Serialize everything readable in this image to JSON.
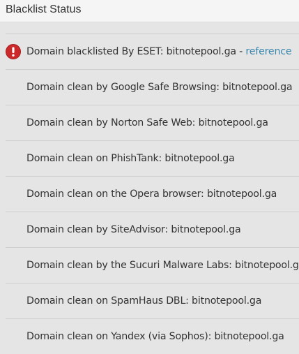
{
  "header": {
    "title": "Blacklist Status"
  },
  "items": [
    {
      "text": "Domain blacklisted By ESET: bitnotepool.ga",
      "separator": " - ",
      "link": "reference",
      "status": "blacklisted"
    },
    {
      "text": "Domain clean by Google Safe Browsing: bitnotepool.ga",
      "status": "clean"
    },
    {
      "text": "Domain clean by Norton Safe Web: bitnotepool.ga",
      "status": "clean"
    },
    {
      "text": "Domain clean on PhishTank: bitnotepool.ga",
      "status": "clean"
    },
    {
      "text": "Domain clean on the Opera browser: bitnotepool.ga",
      "status": "clean"
    },
    {
      "text": "Domain clean by SiteAdvisor: bitnotepool.ga",
      "status": "clean"
    },
    {
      "text": "Domain clean by the Sucuri Malware Labs: bitnotepool.ga",
      "status": "clean"
    },
    {
      "text": "Domain clean on SpamHaus DBL: bitnotepool.ga",
      "status": "clean"
    },
    {
      "text": "Domain clean on Yandex (via Sophos): bitnotepool.ga",
      "status": "clean"
    }
  ],
  "icons": {
    "blacklisted": "exclamation-circle-icon"
  },
  "colors": {
    "alert_red": "#cc2a2a",
    "link_blue": "#3a87ad",
    "text": "#333333",
    "background": "#e5e5e5",
    "header_background": "#f5f5f5"
  }
}
